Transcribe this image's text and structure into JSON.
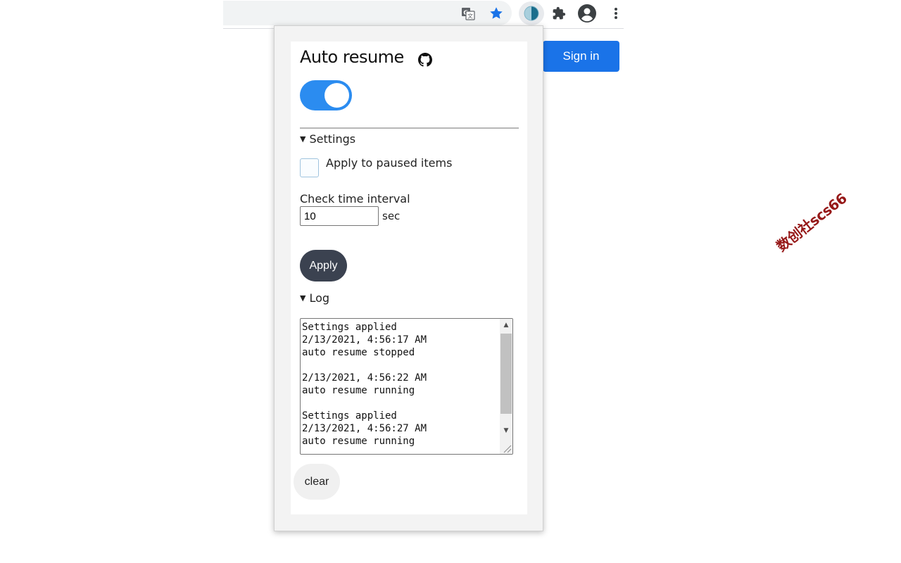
{
  "browser": {
    "icons": [
      "translate-icon",
      "bookmark-star-icon",
      "auto-resume-extension-icon",
      "extensions-puzzle-icon",
      "profile-icon",
      "more-menu-icon"
    ],
    "accent": "#1a73e8"
  },
  "page": {
    "signin_label": "Sign in"
  },
  "popup": {
    "title": "Auto resume",
    "title_icon": "github-icon",
    "toggle_on": true,
    "toggle_color": "#2b8cf0",
    "settings_summary": "Settings",
    "apply_paused_label": "Apply to paused items",
    "apply_paused_checked": false,
    "interval_label": "Check time interval",
    "interval_value": "10",
    "interval_unit": "sec",
    "apply_label": "Apply",
    "log_summary": "Log",
    "log_text": "Settings applied\n2/13/2021, 4:56:17 AM\nauto resume stopped\n\n2/13/2021, 4:56:22 AM\nauto resume running\n\nSettings applied\n2/13/2021, 4:56:27 AM\nauto resume running",
    "clear_label": "clear"
  },
  "watermark": "数创社scs66"
}
